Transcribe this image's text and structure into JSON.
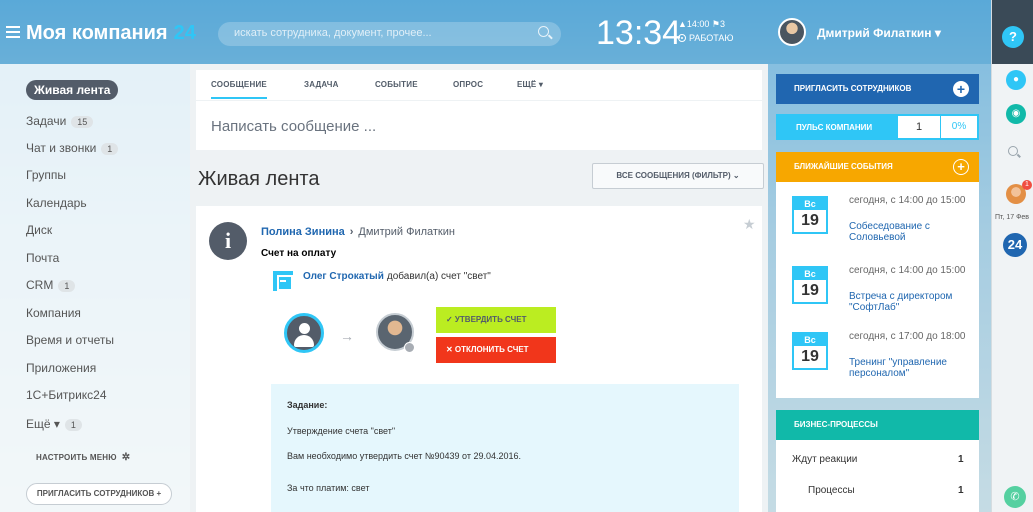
{
  "header": {
    "logo_text": "Моя компания",
    "logo_num": "24",
    "search_placeholder": "искать сотрудника, документ, прочее...",
    "clock": "13:34",
    "clock_meta": "▲14:00  ⚑3",
    "work_status": "РАБОТАЮ",
    "user_name": "Дмитрий Филаткин ▾"
  },
  "sidebar": {
    "items": [
      {
        "label": "Живая лента",
        "count": null
      },
      {
        "label": "Задачи",
        "count": "15"
      },
      {
        "label": "Чат и звонки",
        "count": "1"
      },
      {
        "label": "Группы",
        "count": null
      },
      {
        "label": "Календарь",
        "count": null
      },
      {
        "label": "Диск",
        "count": null
      },
      {
        "label": "Почта",
        "count": null
      },
      {
        "label": "CRM",
        "count": "1"
      },
      {
        "label": "Компания",
        "count": null
      },
      {
        "label": "Время и отчеты",
        "count": null
      },
      {
        "label": "Приложения",
        "count": null
      },
      {
        "label": "1С+Битрикс24",
        "count": null
      },
      {
        "label": "Ещё ▾",
        "count": "1"
      }
    ],
    "settings_label": "НАСТРОИТЬ МЕНЮ",
    "invite_label": "ПРИГЛАСИТЬ СОТРУДНИКОВ +"
  },
  "composer": {
    "tabs": [
      "СООБЩЕНИЕ",
      "ЗАДАЧА",
      "СОБЫТИЕ",
      "ОПРОС",
      "ЕЩЁ ▾"
    ],
    "placeholder": "Написать сообщение ..."
  },
  "feed": {
    "title": "Живая лента",
    "filter_label": "ВСЕ СООБЩЕНИЯ (ФИЛЬТР)  ⌄"
  },
  "post": {
    "author": "Полина Зинина",
    "recipient": "Дмитрий Филаткин",
    "subject": "Счет на оплату",
    "actor": "Олег Строкатый",
    "action_text": "добавил(а) счет \"свет\"",
    "approve_label": "✓  УТВЕРДИТЬ СЧЕТ",
    "reject_label": "✕  ОТКЛОНИТЬ СЧЕТ",
    "task_heading": "Задание:",
    "task_line1": "Утверждение счета \"свет\"",
    "task_line2": "Вам необходимо утвердить счет №90439 от 29.04.2016.",
    "task_line3": "За что платим: свет"
  },
  "right": {
    "invite_label": "ПРИГЛАСИТЬ СОТРУДНИКОВ",
    "pulse_label": "ПУЛЬС КОМПАНИИ",
    "pulse_value": "1",
    "pulse_percent": "0%",
    "events_label": "БЛИЖАЙШИЕ СОБЫТИЯ",
    "events": [
      {
        "dow": "Вс",
        "day": "19",
        "time": "сегодня, с 14:00 до 15:00",
        "title": "Собеседование с Соловьевой"
      },
      {
        "dow": "Вс",
        "day": "19",
        "time": "сегодня, с 14:00 до 15:00",
        "title": "Встреча с директором \"СофтЛаб\""
      },
      {
        "dow": "Вс",
        "day": "19",
        "time": "сегодня, с 17:00 до 18:00",
        "title": "Тренинг \"управление персоналом\""
      }
    ],
    "bp_label": "БИЗНЕС-ПРОЦЕССЫ",
    "bp_rows": [
      {
        "label": "Ждут реакции",
        "count": "1"
      },
      {
        "label": "Процессы",
        "count": "1"
      }
    ]
  },
  "rightbar": {
    "help": "?",
    "date": "Пт, 17 Фев",
    "badge": "1",
    "logo": "24"
  }
}
